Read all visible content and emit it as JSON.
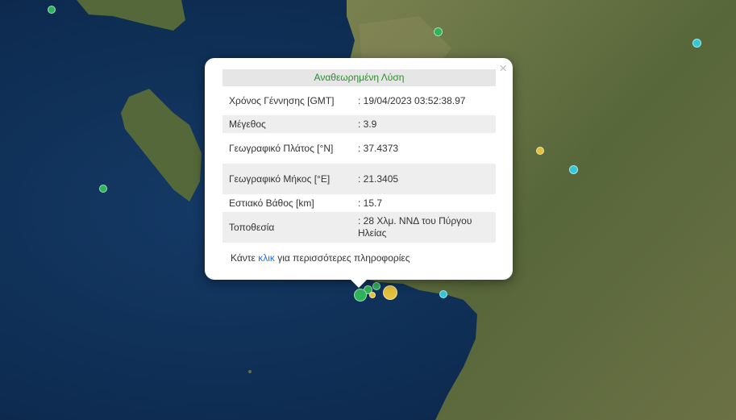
{
  "popup": {
    "title": "Αναθεωρημένη Λύση",
    "close_label": "×",
    "rows": [
      {
        "label": "Χρόνος Γέννησης [GMT]",
        "value": ": 19/04/2023 03:52:38.97"
      },
      {
        "label": "Μέγεθος",
        "value": ": 3.9"
      },
      {
        "label": "Γεωγραφικό Πλάτος [°N]",
        "value": ": 37.4373"
      },
      {
        "label": "Γεωγραφικό Μήκος [°E]",
        "value": ": 21.3405"
      },
      {
        "label": "Εστιακό Βάθος [km]",
        "value": ": 15.7"
      },
      {
        "label": "Τοποθεσία",
        "value": ": 28 Χλμ. ΝΝΔ του Πύργου Ηλείας"
      }
    ],
    "more_prefix": "Κάντε ",
    "more_link": "κλικ",
    "more_suffix": " για περισσότερες πληροφορίες"
  },
  "colors": {
    "sea": "#10305a",
    "land": "#5c6a3a",
    "marker_green": "#2fb35a",
    "marker_yellow": "#e3c13b",
    "marker_cyan": "#34c7d6",
    "title_green": "#2e8b2e",
    "link_blue": "#1a73e8"
  }
}
